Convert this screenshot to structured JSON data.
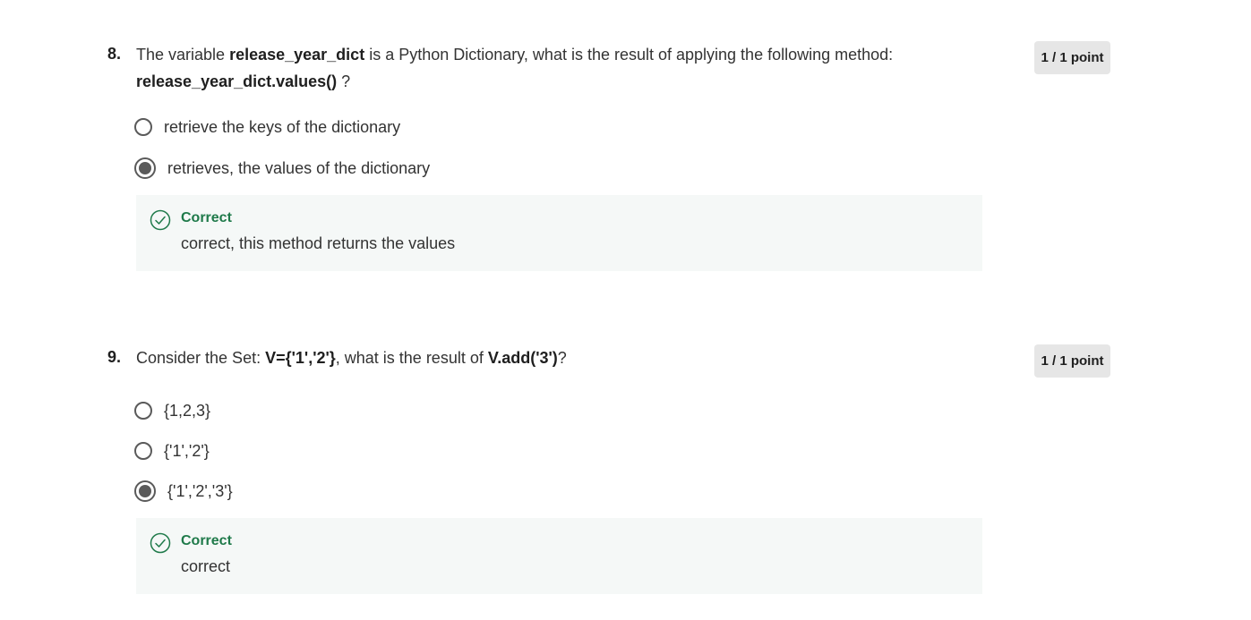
{
  "questions": [
    {
      "number": "8.",
      "text_parts": {
        "p1": "The variable ",
        "b1": "release_year_dict",
        "p2": " is a Python Dictionary, what is the result of applying the following method:",
        "b2": "release_year_dict.values()",
        "p3": " ?"
      },
      "points": "1 / 1 point",
      "options": [
        {
          "label": "retrieve the keys of the dictionary",
          "selected": false
        },
        {
          "label": "retrieves, the values of the dictionary",
          "selected": true
        }
      ],
      "feedback": {
        "title": "Correct",
        "text": "correct, this method returns the values"
      }
    },
    {
      "number": "9.",
      "text_parts": {
        "p1": "Consider the Set: ",
        "b1": "V={'1','2'}",
        "p2": ", what is the result of ",
        "b2": "V.add('3')",
        "p3": "?"
      },
      "points": "1 / 1 point",
      "options": [
        {
          "label": "{1,2,3}",
          "selected": false
        },
        {
          "label": "{'1','2'}",
          "selected": false
        },
        {
          "label": "{'1','2','3'}",
          "selected": true
        }
      ],
      "feedback": {
        "title": "Correct",
        "text": "correct"
      }
    }
  ],
  "icons": {
    "radio_unselected": "radio-unselected-icon",
    "radio_selected": "radio-selected-icon",
    "feedback": "check-circle-icon"
  },
  "colors": {
    "correct_green": "#1f7a4a",
    "feedback_bg": "#f5f8f7",
    "points_bg": "#e6e6e6"
  }
}
